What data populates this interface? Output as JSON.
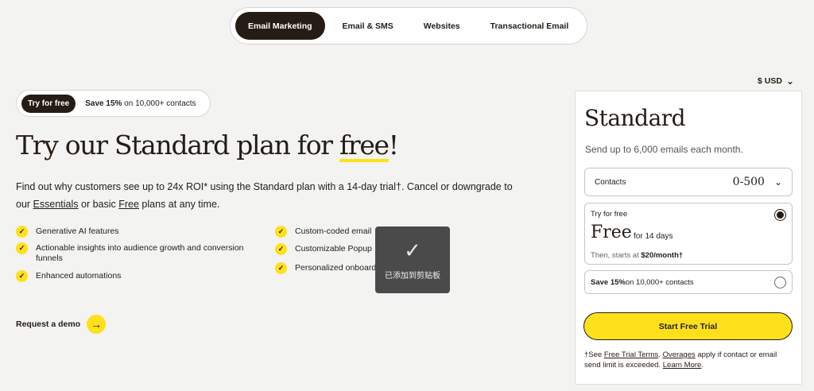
{
  "nav": {
    "tabs": [
      {
        "label": "Email Marketing",
        "active": true
      },
      {
        "label": "Email & SMS"
      },
      {
        "label": "Websites"
      },
      {
        "label": "Transactional Email"
      }
    ]
  },
  "promo": {
    "pill_dark": "Try for free",
    "pill_bold": "Save 15%",
    "pill_rest": " on 10,000+ contacts"
  },
  "hero": {
    "headline_pre": "Try our Standard plan for ",
    "headline_hl": "free",
    "headline_post": "!",
    "sub_1": "Find out why customers see up to 24x ROI* using the Standard plan with a 14-day trial†. Cancel or downgrade to our ",
    "sub_link1": "Essentials",
    "sub_2": " or basic ",
    "sub_link2": "Free",
    "sub_3": " plans at any time."
  },
  "features": {
    "left": [
      "Generative AI features",
      "Actionable insights into audience growth and conversion funnels",
      "Enhanced automations"
    ],
    "right": [
      "Custom-coded email",
      "Customizable Popup",
      "Personalized onboard"
    ]
  },
  "demo": {
    "label": "Request a demo"
  },
  "toast": {
    "label": "已添加到剪贴板"
  },
  "currency": {
    "label": "$ USD",
    "chevron": "⌄"
  },
  "card": {
    "title": "Standard",
    "desc": "Send up to 6,000 emails each month.",
    "contacts_label": "Contacts",
    "contacts_value": "0-500",
    "opt1_label": "Try for free",
    "opt1_big": "Free",
    "opt1_for": "for 14 days",
    "opt1_then": "Then, starts at ",
    "opt1_price": "$20/month†",
    "opt2_bold": "Save 15%",
    "opt2_rest": " on 10,000+ contacts",
    "cta": "Start Free Trial",
    "fine_1": "†See ",
    "fine_link1": "Free Trial Terms",
    "fine_2": ". ",
    "fine_link2": "Overages",
    "fine_3": " apply if contact or email send limit is exceeded. ",
    "fine_link3": "Learn More",
    "fine_4": "."
  },
  "colors": {
    "accent": "#ffe01b",
    "dark": "#241c15",
    "bg": "#f3f3f1"
  }
}
